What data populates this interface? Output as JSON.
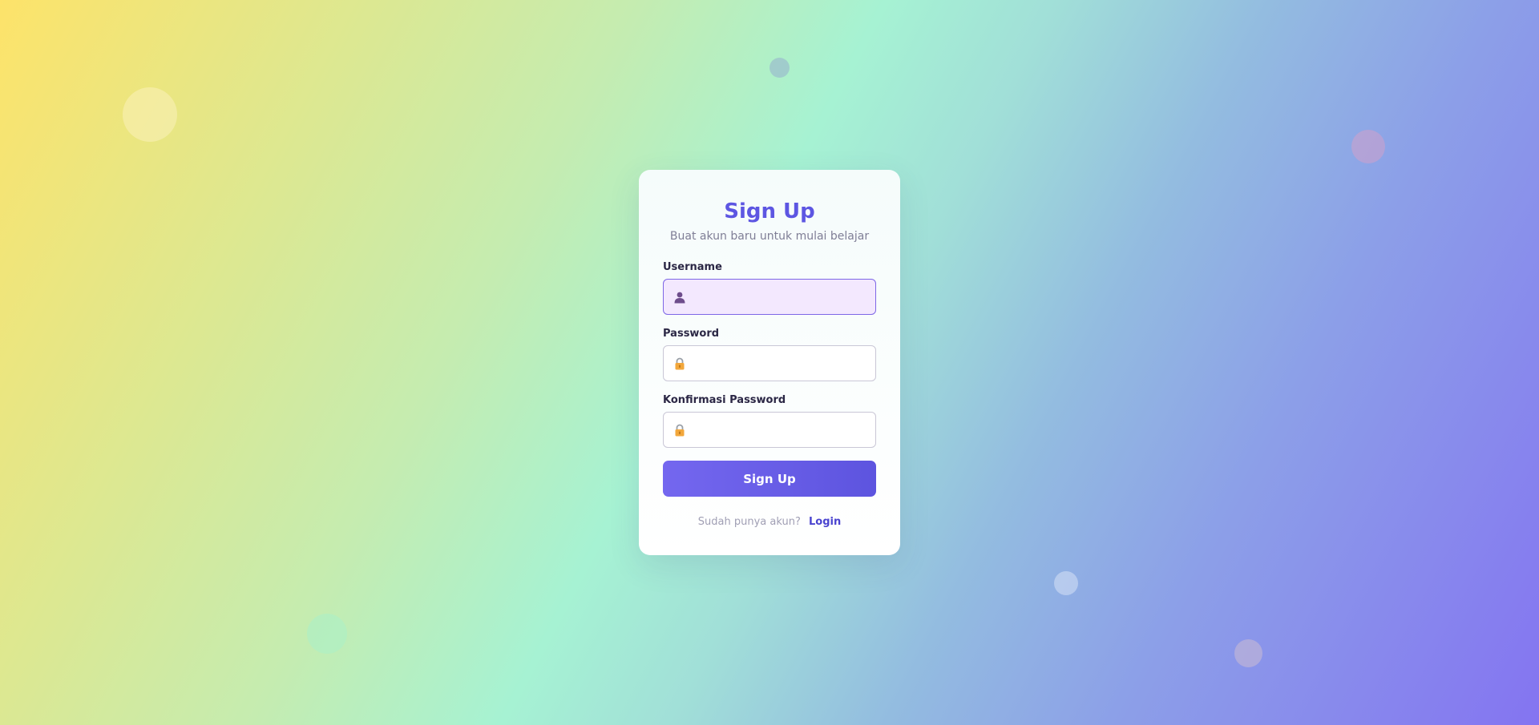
{
  "signup": {
    "title": "Sign Up",
    "subtitle": "Buat akun baru untuk mulai belajar",
    "username_label": "Username",
    "username_value": "",
    "password_label": "Password",
    "password_value": "",
    "confirm_label": "Konfirmasi Password",
    "confirm_value": "",
    "submit_label": "Sign Up",
    "footer_text": "Sudah punya akun?",
    "login_link": "Login"
  },
  "icons": {
    "username": "user-icon",
    "password": "lock-icon",
    "confirm": "lock-icon"
  },
  "colors": {
    "accent": "#5d56e2",
    "button": "#6a5fe8",
    "active_field_bg": "#f3e8fe",
    "link": "#4a44cf"
  }
}
